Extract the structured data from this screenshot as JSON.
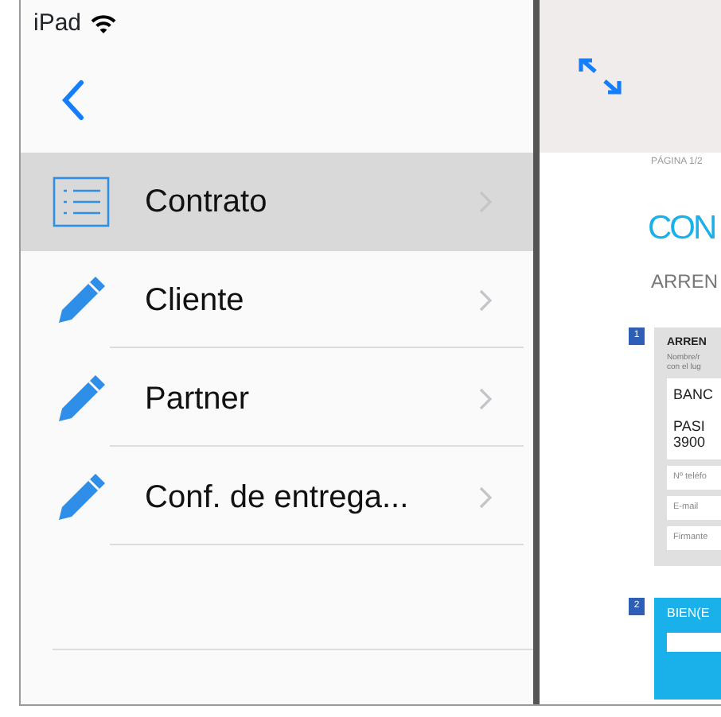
{
  "status_bar": {
    "device": "iPad"
  },
  "menu": [
    {
      "label": "Contrato",
      "kind": "list",
      "selected": true
    },
    {
      "label": "Cliente",
      "kind": "edit",
      "selected": false
    },
    {
      "label": "Partner",
      "kind": "edit",
      "selected": false
    },
    {
      "label": "Conf. de entrega...",
      "kind": "edit",
      "selected": false
    }
  ],
  "document": {
    "page_label": "PÁGINA 1/2",
    "title": "CON",
    "subtitle": "ARREN",
    "sections": [
      {
        "number": "1",
        "kind": "form",
        "heading": "ARREN",
        "hint_lines": [
          "Nombre/r",
          "con el lug"
        ],
        "address_lines": [
          "BANC",
          "PASI",
          "3900"
        ],
        "fields": [
          {
            "placeholder": "Nº teléfo"
          },
          {
            "placeholder": "E-mail"
          },
          {
            "placeholder": "Firmante"
          }
        ]
      },
      {
        "number": "2",
        "kind": "banner",
        "heading": "BIEN(E"
      }
    ]
  }
}
